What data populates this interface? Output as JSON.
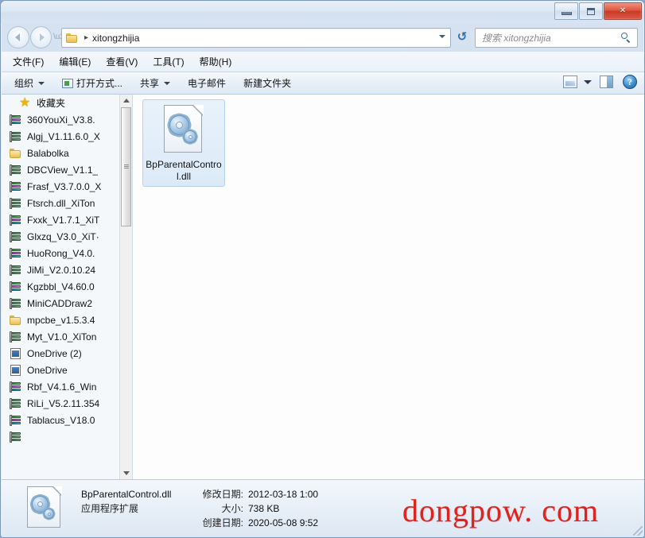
{
  "window": {
    "title": "",
    "buttons": {
      "minimize": "minimize",
      "maximize": "maximize",
      "close": "×"
    }
  },
  "address": {
    "crumb_separator": "▸",
    "path": "xitongzhijia",
    "refresh_glyph": "↺"
  },
  "search": {
    "placeholder": "搜索 xitongzhijia"
  },
  "menubar": {
    "items": [
      {
        "label": "文件(F)"
      },
      {
        "label": "编辑(E)"
      },
      {
        "label": "查看(V)"
      },
      {
        "label": "工具(T)"
      },
      {
        "label": "帮助(H)"
      }
    ]
  },
  "toolbar": {
    "organize": "组织",
    "open_with": "打开方式...",
    "share": "共享",
    "email": "电子邮件",
    "new_folder": "新建文件夹",
    "help_glyph": "?"
  },
  "sidebar": {
    "header": {
      "label": "收藏夹",
      "icon": "star-icon"
    },
    "items": [
      {
        "label": "360YouXi_V3.8.",
        "icon": "rar-icon"
      },
      {
        "label": "Algj_V1.11.6.0_X",
        "icon": "rar-icon"
      },
      {
        "label": "Balabolka",
        "icon": "folder-icon"
      },
      {
        "label": "DBCView_V1.1_",
        "icon": "rar-icon"
      },
      {
        "label": "Frasf_V3.7.0.0_X",
        "icon": "rar-icon"
      },
      {
        "label": "Ftsrch.dll_XiTon",
        "icon": "rar-icon"
      },
      {
        "label": "Fxxk_V1.7.1_XiT",
        "icon": "rar-icon"
      },
      {
        "label": "Glxzq_V3.0_XiT·",
        "icon": "rar-icon"
      },
      {
        "label": "HuoRong_V4.0.",
        "icon": "rar-icon"
      },
      {
        "label": "JiMi_V2.0.10.24",
        "icon": "rar-icon"
      },
      {
        "label": "Kgzbbl_V4.60.0",
        "icon": "rar-icon"
      },
      {
        "label": "MiniCADDraw2",
        "icon": "rar-icon"
      },
      {
        "label": "mpcbe_v1.5.3.4",
        "icon": "folder-icon"
      },
      {
        "label": "Myt_V1.0_XiTon",
        "icon": "rar-icon"
      },
      {
        "label": "OneDrive (2)",
        "icon": "shortcut-icon"
      },
      {
        "label": "OneDrive",
        "icon": "shortcut-icon"
      },
      {
        "label": "Rbf_V4.1.6_Win",
        "icon": "rar-icon"
      },
      {
        "label": "RiLi_V5.2.11.354",
        "icon": "rar-icon"
      },
      {
        "label": "Tablacus_V18.0",
        "icon": "rar-icon"
      }
    ]
  },
  "files": [
    {
      "name": "BpParentalControl.dll",
      "display_label": "BpParentalControl.dll",
      "icon": "dll-gear-icon",
      "selected": true
    }
  ],
  "details": {
    "file_name": "BpParentalControl.dll",
    "file_type": "应用程序扩展",
    "modified_label": "修改日期:",
    "modified_value": "2012-03-18 1:00",
    "size_label": "大小:",
    "size_value": "738 KB",
    "created_label": "创建日期:",
    "created_value": "2020-05-08 9:52"
  },
  "watermark": {
    "text": "dongpow. com",
    "color": "#e0231e"
  },
  "colors": {
    "frame": "#c7d6e8",
    "accent": "#3d6d9e",
    "selection": "#dceaf8",
    "pane_bg": "#fdfdfd"
  }
}
